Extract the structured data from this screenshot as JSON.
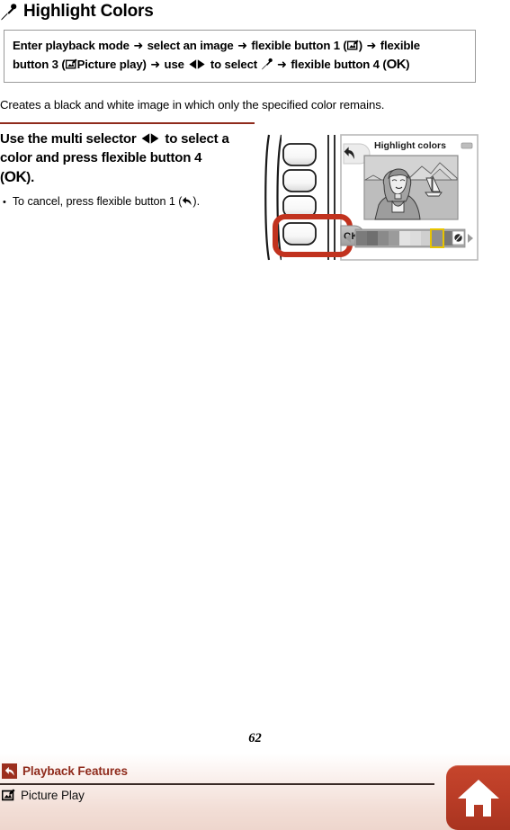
{
  "page": {
    "number": "62",
    "title": "Highlight Colors",
    "title_icon": "eyedropper-icon"
  },
  "procedure": {
    "line1_part1": "Enter playback mode",
    "line1_part2": "select an image",
    "line1_part3": "flexible button 1 (",
    "line1_part4": ")",
    "line1_part5": "flexible",
    "line2_part1": "button 3 (",
    "line2_part2": "Picture play)",
    "line2_part3": "use",
    "line2_part4": "to select",
    "line2_part5": "flexible button 4 (",
    "line2_ok": "OK",
    "line2_part6": ")",
    "arrow": "➜",
    "icons": {
      "picture_play": "picture-play-icon",
      "multi_selector": "left-right-arrows-icon",
      "dropper": "eyedropper-icon"
    }
  },
  "description": "Creates a black and white image in which only the specified color remains.",
  "step": {
    "heading_part1": "Use the multi selector",
    "heading_part2": "to select",
    "heading_line2": "a color and press flexible button 4",
    "heading_line3_open": "(",
    "heading_ok": "OK",
    "heading_line3_close": ").",
    "bullet1_pre": "To cancel, press flexible button 1 (",
    "bullet1_post": ").",
    "bullet_marker": "•",
    "back_icon": "back-arrow-icon"
  },
  "camera": {
    "lcd_title": "Highlight colors",
    "back_icon": "back-arrow-icon",
    "ok_label": "OK",
    "battery_icon": "battery-icon",
    "no_color_icon": "no-color-icon",
    "left_arrow_icon": "left-triangle-icon",
    "right_arrow_icon": "right-triangle-icon",
    "highlight_color": "#c1321e",
    "selection_color": "#e8c400",
    "button_count": 4,
    "highlighted_button_index": 4
  },
  "footer": {
    "back_link": "Playback Features",
    "back_icon": "back-arrow-icon",
    "section_link": "Picture Play",
    "section_icon": "picture-play-icon",
    "home_icon": "home-icon",
    "accent_color": "#8f2b1c",
    "home_button_color": "#bb3d27"
  }
}
